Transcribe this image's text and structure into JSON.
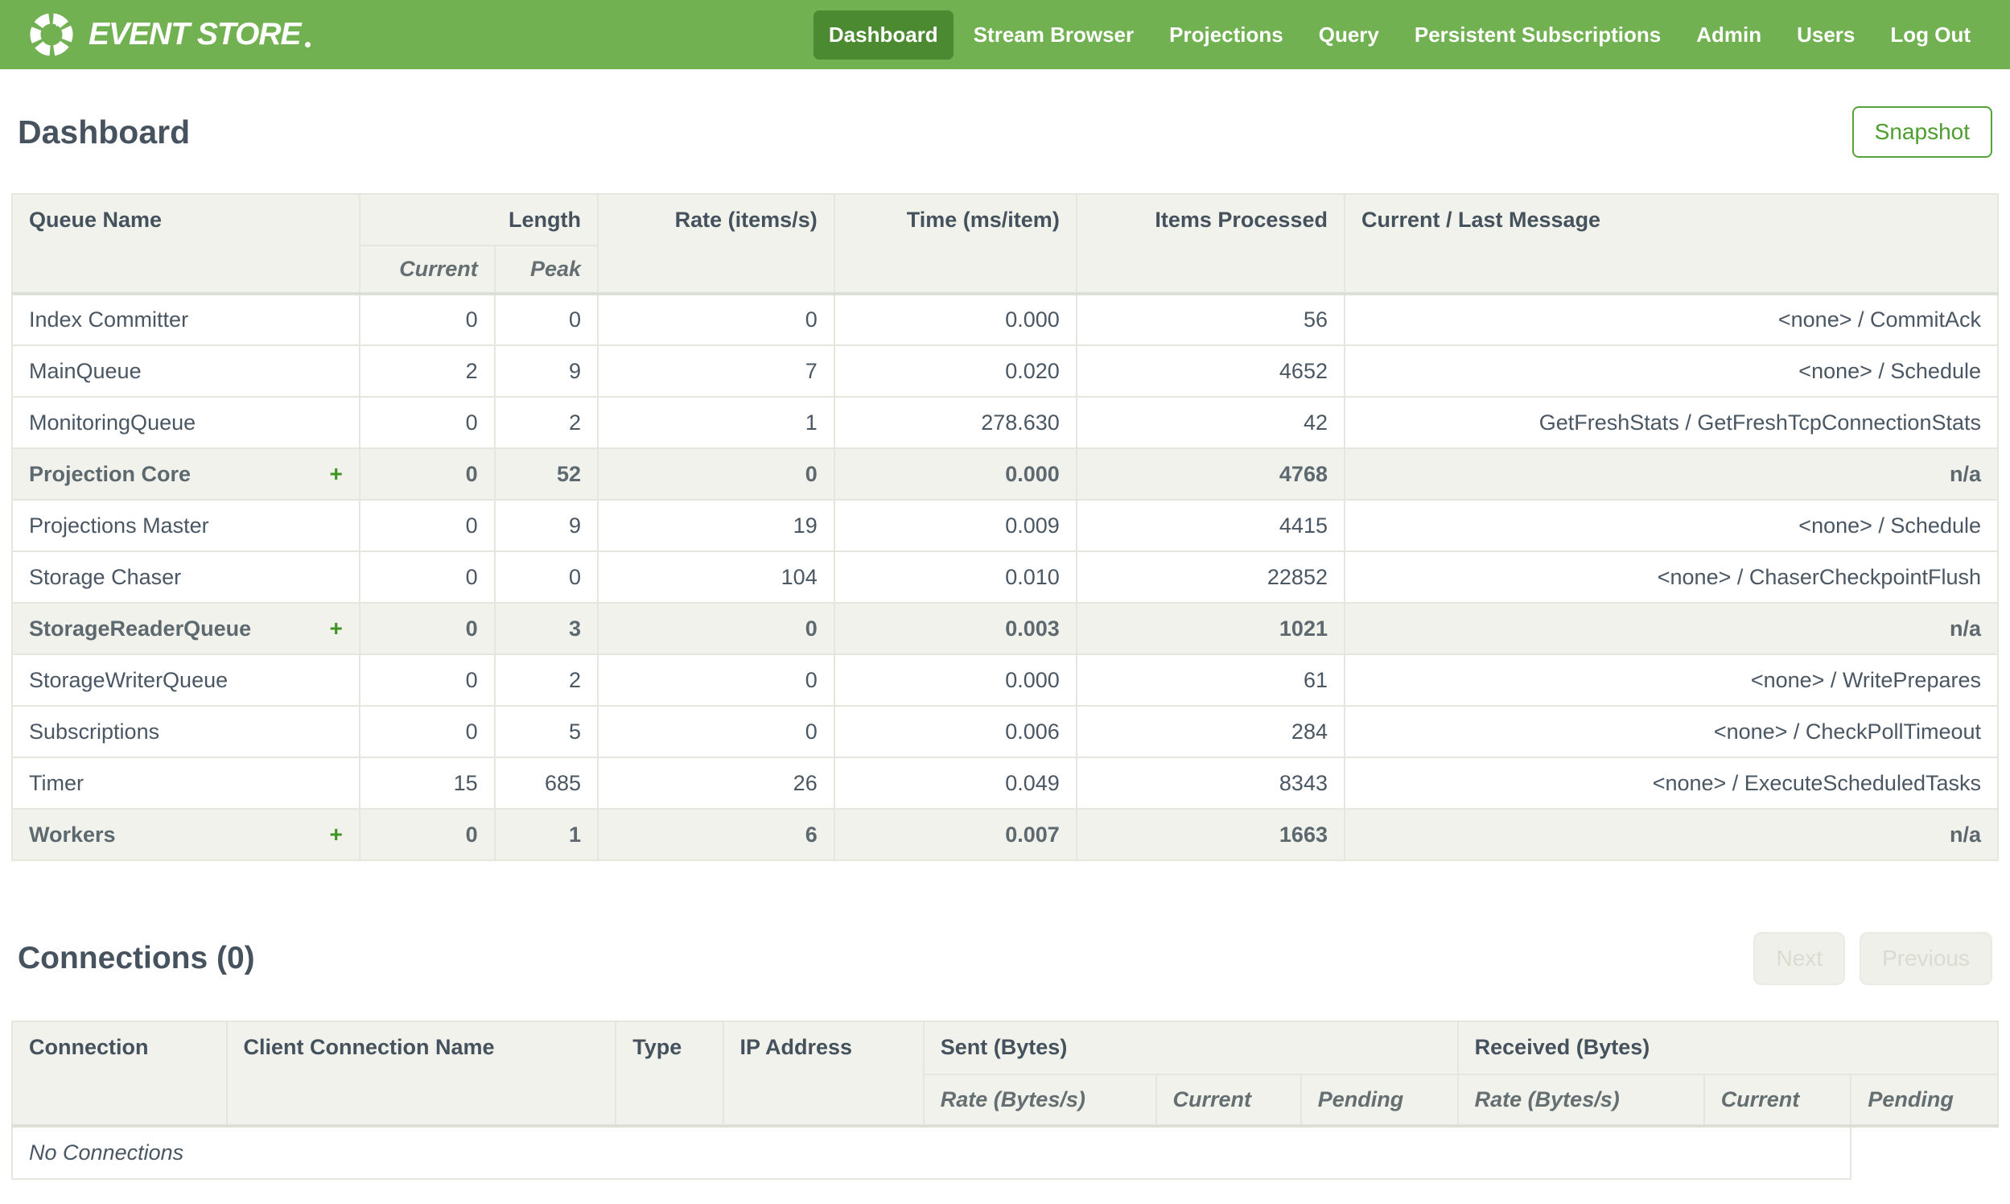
{
  "nav": {
    "brand": "EVENT STORE",
    "items": [
      {
        "label": "Dashboard",
        "active": true
      },
      {
        "label": "Stream Browser",
        "active": false
      },
      {
        "label": "Projections",
        "active": false
      },
      {
        "label": "Query",
        "active": false
      },
      {
        "label": "Persistent Subscriptions",
        "active": false
      },
      {
        "label": "Admin",
        "active": false
      },
      {
        "label": "Users",
        "active": false
      },
      {
        "label": "Log Out",
        "active": false
      }
    ]
  },
  "page": {
    "title": "Dashboard",
    "snapshot_label": "Snapshot"
  },
  "queues_table": {
    "expand_icon": "+",
    "headers": {
      "queue_name": "Queue Name",
      "length": "Length",
      "current": "Current",
      "peak": "Peak",
      "rate": "Rate (items/s)",
      "time": "Time (ms/item)",
      "items_processed": "Items Processed",
      "message": "Current / Last Message"
    },
    "rows": [
      {
        "name": "Index Committer",
        "expandable": false,
        "current": "0",
        "peak": "0",
        "rate": "0",
        "time": "0.000",
        "items": "56",
        "message": "<none> / CommitAck"
      },
      {
        "name": "MainQueue",
        "expandable": false,
        "current": "2",
        "peak": "9",
        "rate": "7",
        "time": "0.020",
        "items": "4652",
        "message": "<none> / Schedule"
      },
      {
        "name": "MonitoringQueue",
        "expandable": false,
        "current": "0",
        "peak": "2",
        "rate": "1",
        "time": "278.630",
        "items": "42",
        "message": "GetFreshStats / GetFreshTcpConnectionStats"
      },
      {
        "name": "Projection Core",
        "expandable": true,
        "current": "0",
        "peak": "52",
        "rate": "0",
        "time": "0.000",
        "items": "4768",
        "message": "n/a"
      },
      {
        "name": "Projections Master",
        "expandable": false,
        "current": "0",
        "peak": "9",
        "rate": "19",
        "time": "0.009",
        "items": "4415",
        "message": "<none> / Schedule"
      },
      {
        "name": "Storage Chaser",
        "expandable": false,
        "current": "0",
        "peak": "0",
        "rate": "104",
        "time": "0.010",
        "items": "22852",
        "message": "<none> / ChaserCheckpointFlush"
      },
      {
        "name": "StorageReaderQueue",
        "expandable": true,
        "current": "0",
        "peak": "3",
        "rate": "0",
        "time": "0.003",
        "items": "1021",
        "message": "n/a"
      },
      {
        "name": "StorageWriterQueue",
        "expandable": false,
        "current": "0",
        "peak": "2",
        "rate": "0",
        "time": "0.000",
        "items": "61",
        "message": "<none> / WritePrepares"
      },
      {
        "name": "Subscriptions",
        "expandable": false,
        "current": "0",
        "peak": "5",
        "rate": "0",
        "time": "0.006",
        "items": "284",
        "message": "<none> / CheckPollTimeout"
      },
      {
        "name": "Timer",
        "expandable": false,
        "current": "15",
        "peak": "685",
        "rate": "26",
        "time": "0.049",
        "items": "8343",
        "message": "<none> / ExecuteScheduledTasks"
      },
      {
        "name": "Workers",
        "expandable": true,
        "current": "0",
        "peak": "1",
        "rate": "6",
        "time": "0.007",
        "items": "1663",
        "message": "n/a"
      }
    ]
  },
  "connections": {
    "title": "Connections (0)",
    "next_label": "Next",
    "previous_label": "Previous",
    "headers": {
      "connection": "Connection",
      "client_name": "Client Connection Name",
      "type": "Type",
      "ip": "IP Address",
      "sent": "Sent (Bytes)",
      "received": "Received (Bytes)",
      "rate": "Rate (Bytes/s)",
      "current": "Current",
      "pending": "Pending"
    },
    "empty_text": "No Connections"
  },
  "colors": {
    "brand_green": "#71b152",
    "nav_active_green": "#4c8a32",
    "accent_green": "#4d9e2f",
    "heading_text": "#46535f",
    "body_text": "#4a5763",
    "table_header_bg": "#f0f2eb",
    "table_border": "#e5e7df",
    "disabled_button_bg": "#eef0e9",
    "disabled_button_text": "#d9dcd0"
  }
}
